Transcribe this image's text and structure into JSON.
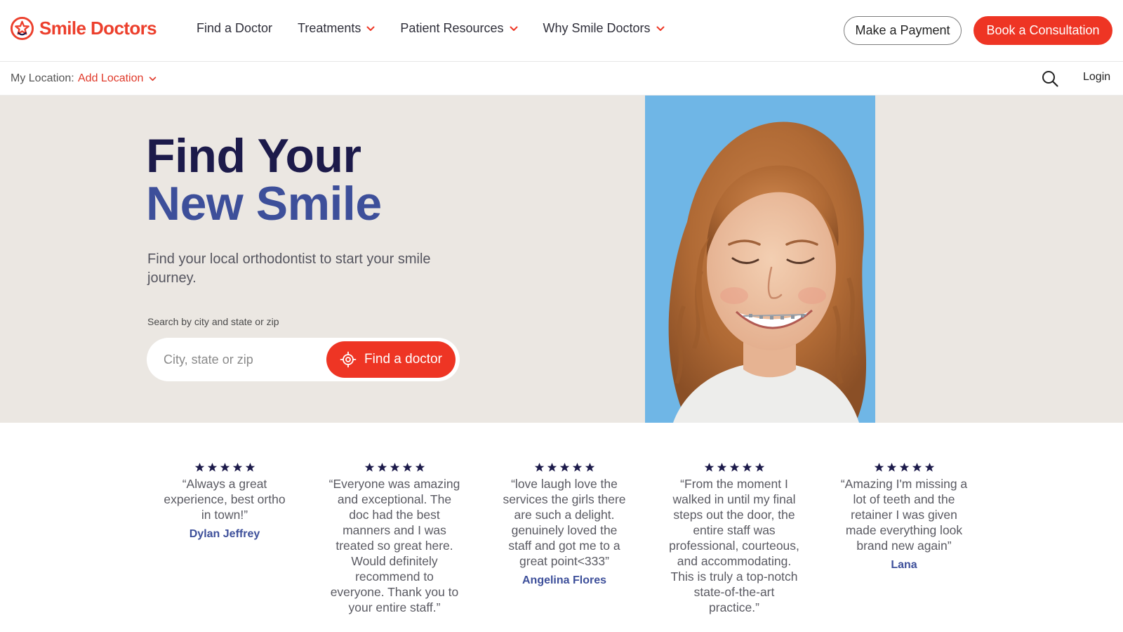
{
  "brand": {
    "name": "Smile Doctors",
    "color": "#ec3f2c",
    "logo_icon": "star-smile-logo-icon"
  },
  "nav": {
    "items": [
      {
        "label": "Find a Doctor",
        "has_dropdown": false
      },
      {
        "label": "Treatments",
        "has_dropdown": true
      },
      {
        "label": "Patient Resources",
        "has_dropdown": true
      },
      {
        "label": "Why Smile Doctors",
        "has_dropdown": true
      }
    ],
    "payment_label": "Make a Payment",
    "consult_label": "Book a Consultation"
  },
  "location_bar": {
    "label": "My Location:",
    "link_label": "Add Location",
    "search_icon": "search-icon",
    "login_label": "Login"
  },
  "hero": {
    "title_line1": "Find Your",
    "title_line2": "New Smile",
    "subtitle": "Find your local orthodontist to start your smile journey.",
    "search_label": "Search by city and state or zip",
    "search_placeholder": "City, state or zip",
    "search_value": "",
    "button_label": "Find a doctor",
    "button_icon": "crosshair-target-icon",
    "photo_background": "#6fb6e6"
  },
  "colors": {
    "accent": "#ee3524",
    "navy": "#1c1a4a",
    "blue": "#3d4f9a",
    "hero_bg": "#ebe7e2"
  },
  "reviews": [
    {
      "rating": 5,
      "quote": "“Always a great experience, best ortho in town!”",
      "author": "Dylan Jeffrey"
    },
    {
      "rating": 5,
      "quote": "“Everyone was amazing and exceptional. The doc had the best manners and I was treated so great here. Would definitely recommend to everyone. Thank you to your entire staff.”",
      "author": ""
    },
    {
      "rating": 5,
      "quote": "“love laugh love the services the girls there are such a delight. genuinely loved the staff and got me to a great point<333”",
      "author": "Angelina Flores"
    },
    {
      "rating": 5,
      "quote": "“From the moment I walked in until my final steps out the door, the entire staff was professional, courteous, and accommodating. This is truly a top-notch state-of-the-art practice.”",
      "author": ""
    },
    {
      "rating": 5,
      "quote": "“Amazing I'm missing a lot of teeth and the retainer I was given made everything look brand new again”",
      "author": "Lana"
    }
  ]
}
